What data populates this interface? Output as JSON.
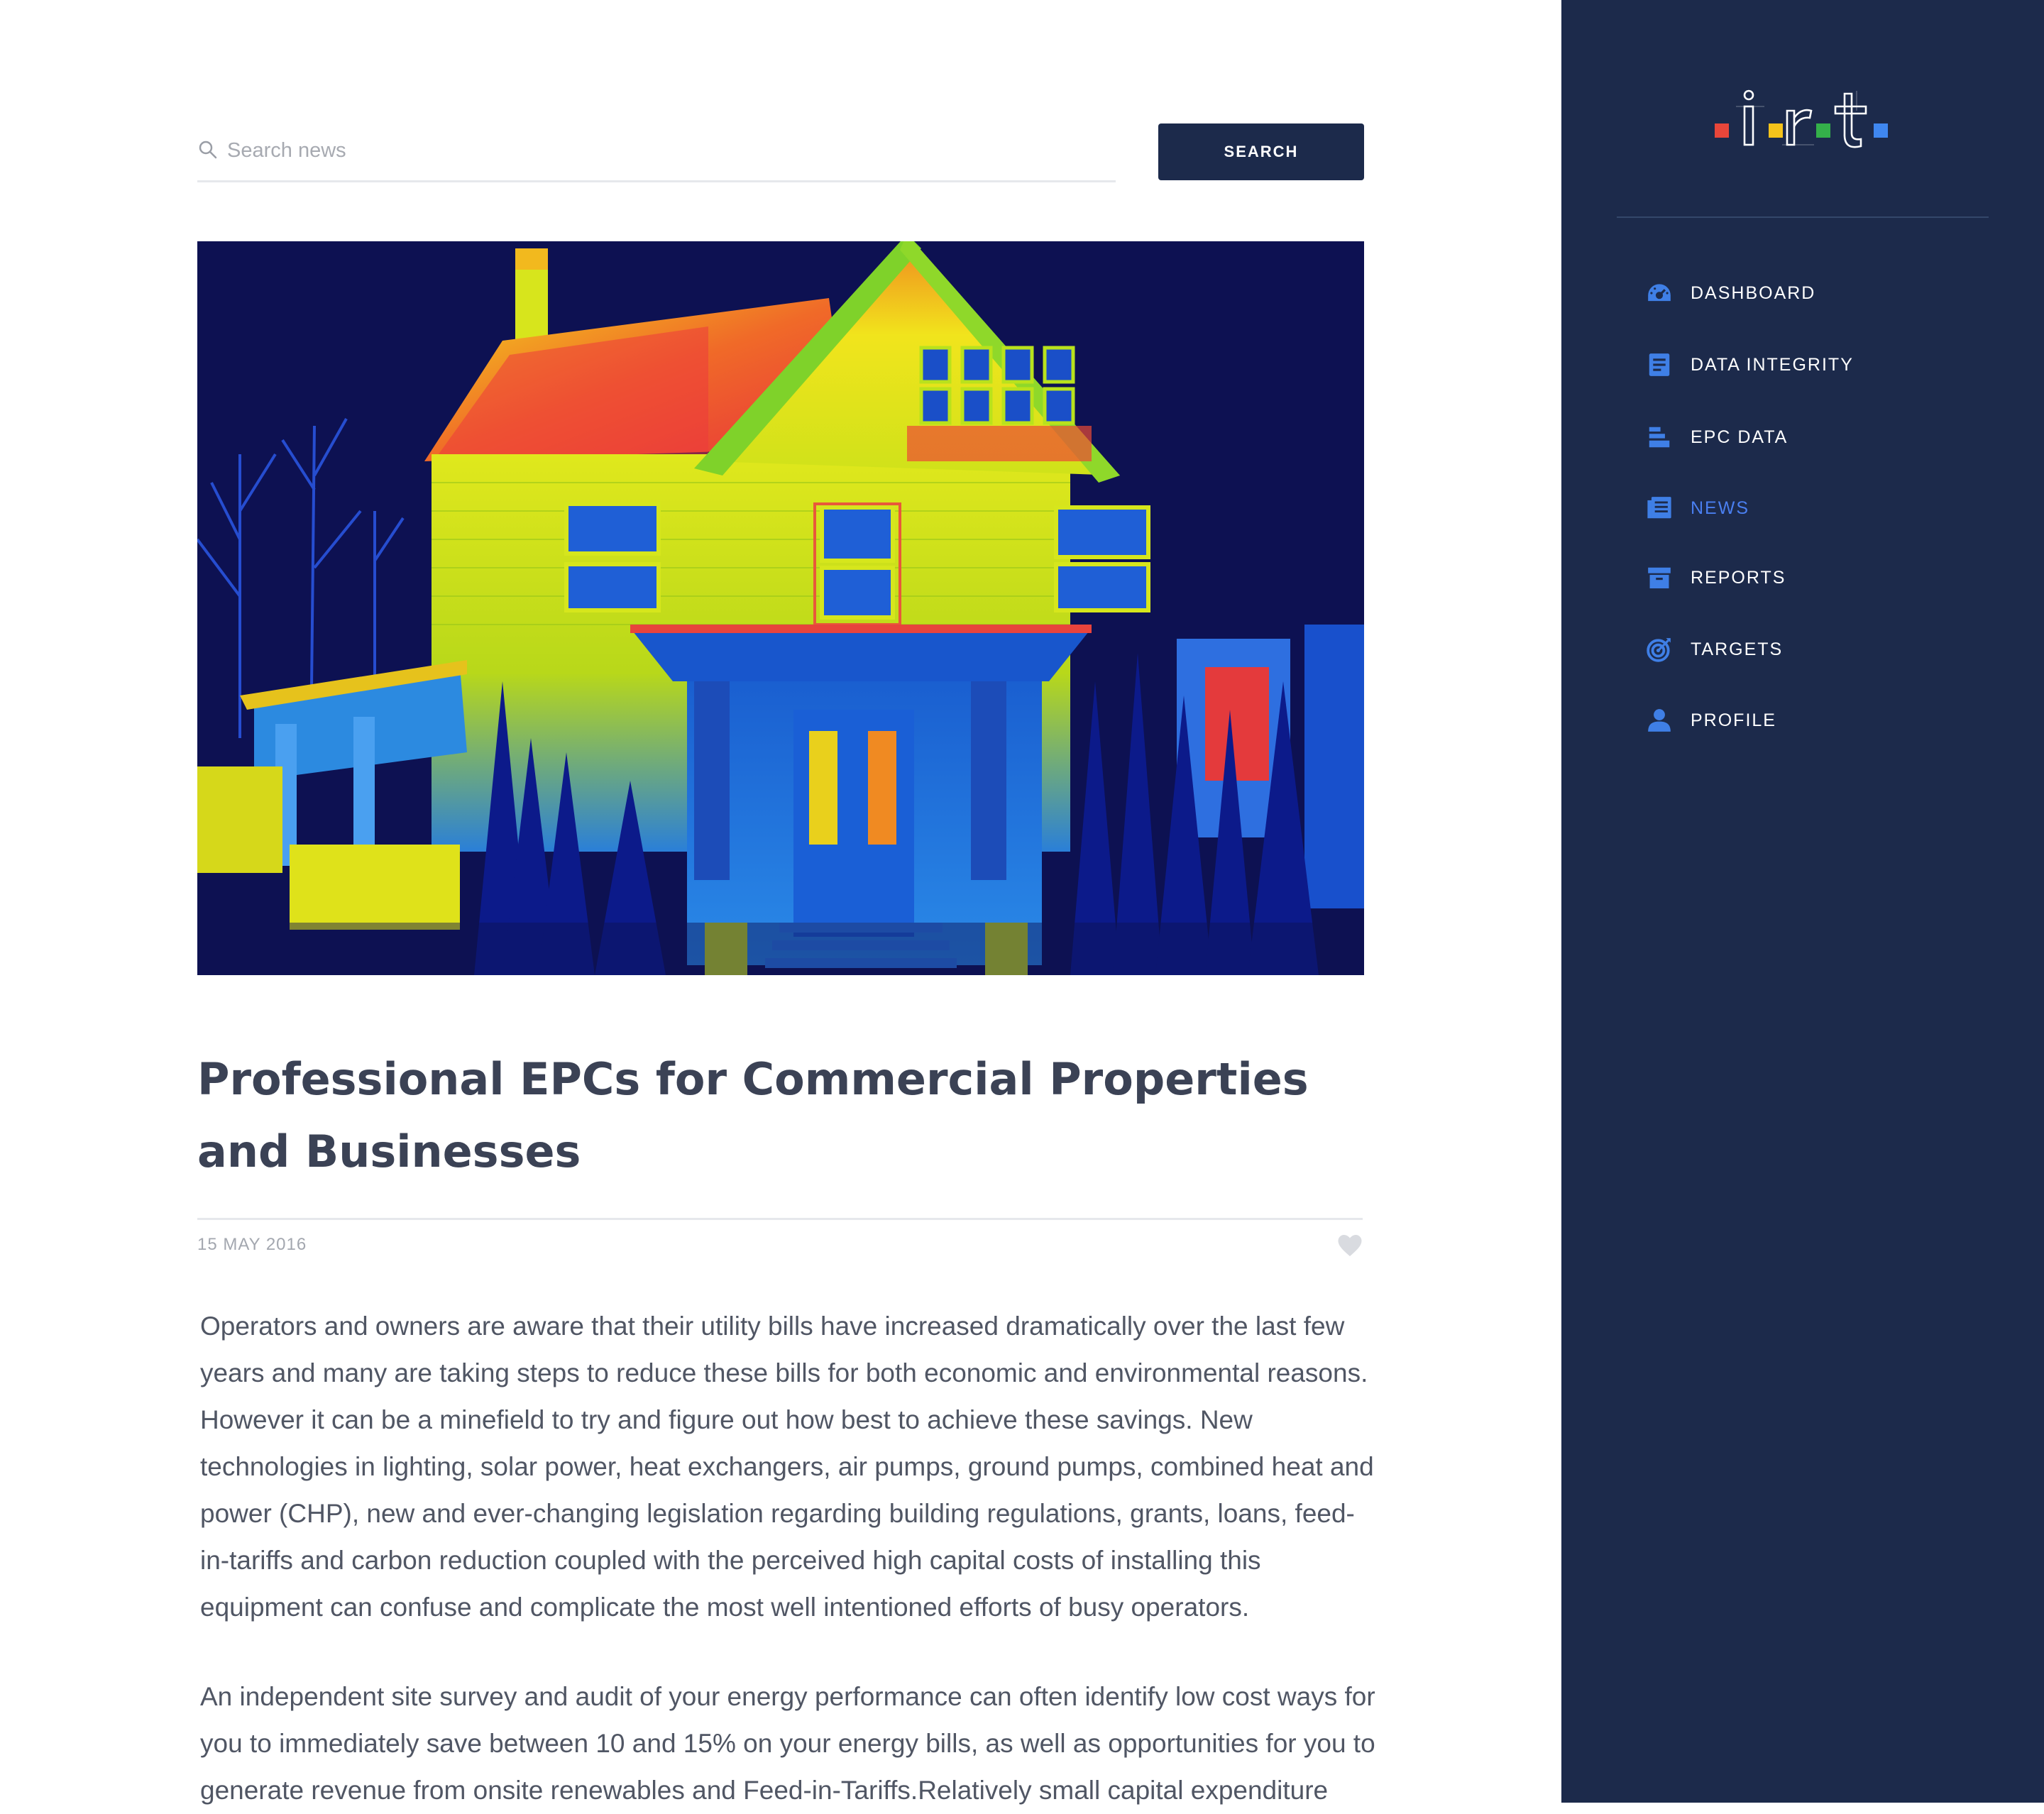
{
  "search": {
    "placeholder": "Search news",
    "button_label": "SEARCH"
  },
  "article": {
    "title": "Professional EPCs for Commercial Properties and Businesses",
    "date": "15 MAY 2016",
    "paragraphs": [
      "Operators and owners are aware that their utility bills have increased dramatically over the last few years and many are taking steps to reduce these bills for both economic and environmental reasons. However it can be a minefield to try and figure out how best to achieve these savings. New technologies in lighting, solar power, heat exchangers, air pumps, ground pumps, combined heat and power (CHP), new and ever-changing legislation regarding building regulations, grants, loans, feed-in-tariffs and carbon reduction coupled with the perceived high capital costs of installing this equipment can confuse and complicate the most well intentioned efforts of busy operators.",
      "An independent site survey and audit of your energy performance can often identify low cost ways for you to immediately save between 10 and 15% on your energy bills, as well as opportunities for you to generate revenue from onsite renewables and Feed-in-Tariffs.Relatively small capital expenditure"
    ]
  },
  "logo": {
    "text": "irt",
    "square_colors": [
      "#e8463a",
      "#f5c31a",
      "#34b04a",
      "#3f87f0"
    ]
  },
  "sidebar": {
    "active_color": "#4a7ff0",
    "items": [
      {
        "label": "DASHBOARD",
        "icon": "gauge-icon"
      },
      {
        "label": "DATA INTEGRITY",
        "icon": "document-icon"
      },
      {
        "label": "EPC DATA",
        "icon": "bars-icon"
      },
      {
        "label": "NEWS",
        "icon": "newspaper-icon",
        "active": true
      },
      {
        "label": "REPORTS",
        "icon": "archive-icon"
      },
      {
        "label": "TARGETS",
        "icon": "target-icon"
      },
      {
        "label": "PROFILE",
        "icon": "user-icon"
      }
    ]
  },
  "colors": {
    "sidebar_bg": "#1c2a4b",
    "button_bg": "#1c2a4b",
    "accent": "#4a7ff0"
  }
}
